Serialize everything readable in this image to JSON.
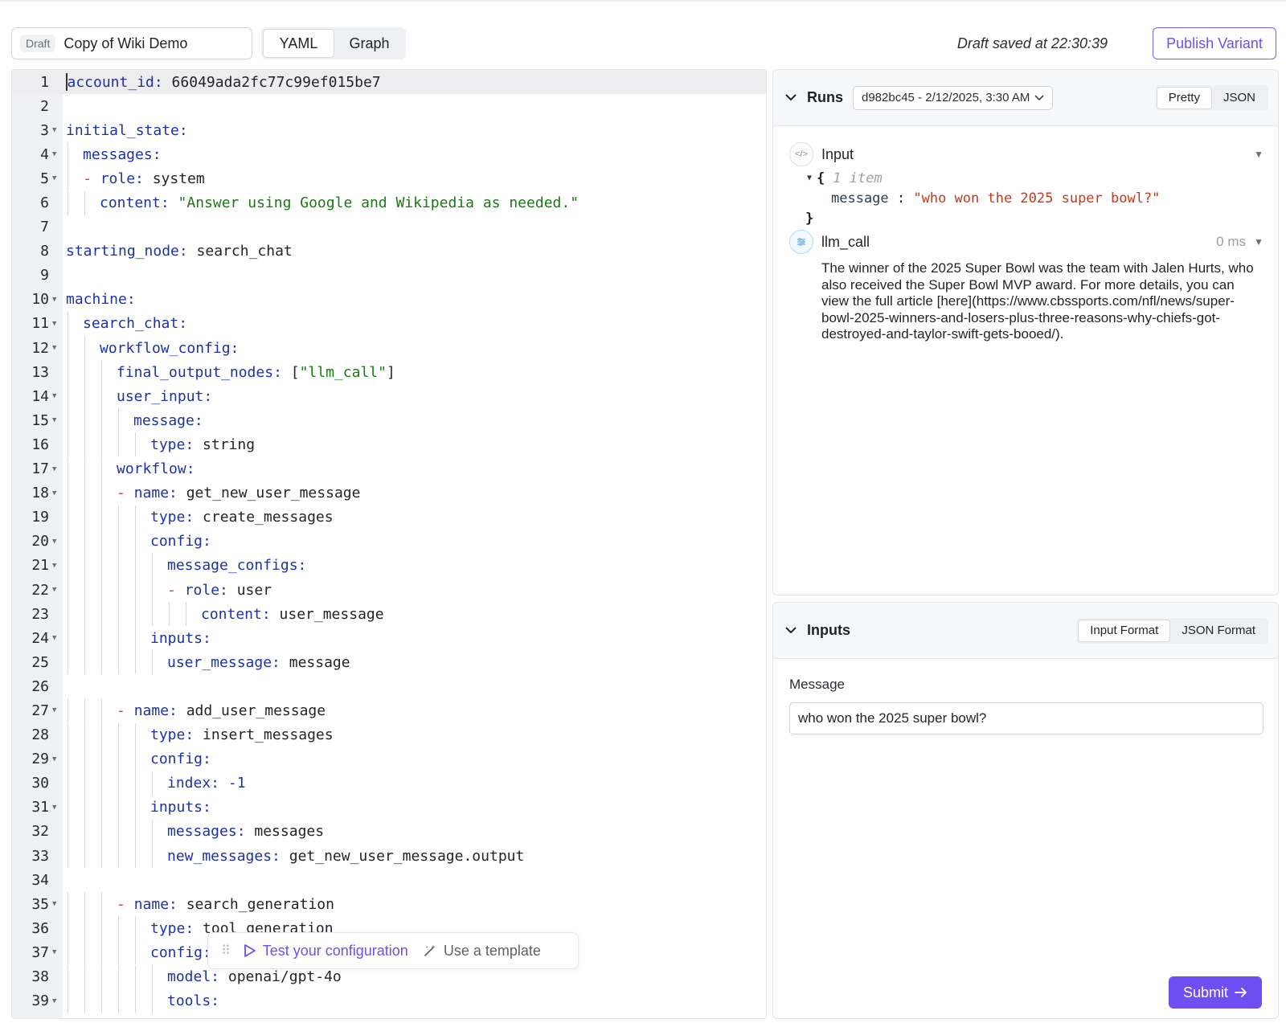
{
  "header": {
    "draft_badge": "Draft",
    "variant_name": "Copy of Wiki Demo",
    "tabs": [
      {
        "label": "YAML",
        "active": true
      },
      {
        "label": "Graph",
        "active": false
      }
    ],
    "saved_text": "Draft saved at 22:30:39",
    "publish_label": "Publish Variant"
  },
  "editor": {
    "lines": [
      {
        "n": "1",
        "fold": false,
        "indent": 0,
        "dash": false,
        "key": "account_id:",
        "val": " 66049ada2fc77c99ef015be7",
        "vclass": "v"
      },
      {
        "n": "2",
        "fold": false,
        "indent": 0,
        "dash": false,
        "key": "",
        "val": "",
        "vclass": "v"
      },
      {
        "n": "3",
        "fold": true,
        "indent": 0,
        "dash": false,
        "key": "initial_state:",
        "val": "",
        "vclass": "v"
      },
      {
        "n": "4",
        "fold": true,
        "indent": 1,
        "dash": false,
        "key": "messages:",
        "val": "",
        "vclass": "v"
      },
      {
        "n": "5",
        "fold": true,
        "indent": 1,
        "dash": true,
        "key": "role:",
        "val": " system",
        "vclass": "v"
      },
      {
        "n": "6",
        "fold": false,
        "indent": 2,
        "dash": false,
        "key": "content:",
        "val": " \"Answer using Google and Wikipedia as needed.\"",
        "vclass": "s"
      },
      {
        "n": "7",
        "fold": false,
        "indent": 0,
        "dash": false,
        "key": "",
        "val": "",
        "vclass": "v"
      },
      {
        "n": "8",
        "fold": false,
        "indent": 0,
        "dash": false,
        "key": "starting_node:",
        "val": " search_chat",
        "vclass": "v"
      },
      {
        "n": "9",
        "fold": false,
        "indent": 0,
        "dash": false,
        "key": "",
        "val": "",
        "vclass": "v"
      },
      {
        "n": "10",
        "fold": true,
        "indent": 0,
        "dash": false,
        "key": "machine:",
        "val": "",
        "vclass": "v"
      },
      {
        "n": "11",
        "fold": true,
        "indent": 1,
        "dash": false,
        "key": "search_chat:",
        "val": "",
        "vclass": "v"
      },
      {
        "n": "12",
        "fold": true,
        "indent": 2,
        "dash": false,
        "key": "workflow_config:",
        "val": "",
        "vclass": "v"
      },
      {
        "n": "13",
        "fold": false,
        "indent": 3,
        "dash": false,
        "key": "final_output_nodes:",
        "val": " [\"llm_call\"]",
        "vclass": "mixed"
      },
      {
        "n": "14",
        "fold": true,
        "indent": 3,
        "dash": false,
        "key": "user_input:",
        "val": "",
        "vclass": "v"
      },
      {
        "n": "15",
        "fold": true,
        "indent": 4,
        "dash": false,
        "key": "message:",
        "val": "",
        "vclass": "v"
      },
      {
        "n": "16",
        "fold": false,
        "indent": 5,
        "dash": false,
        "key": "type:",
        "val": " string",
        "vclass": "v"
      },
      {
        "n": "17",
        "fold": true,
        "indent": 3,
        "dash": false,
        "key": "workflow:",
        "val": "",
        "vclass": "v"
      },
      {
        "n": "18",
        "fold": true,
        "indent": 3,
        "dash": true,
        "key": "name:",
        "val": " get_new_user_message",
        "vclass": "v"
      },
      {
        "n": "19",
        "fold": false,
        "indent": 5,
        "dash": false,
        "key": "type:",
        "val": " create_messages",
        "vclass": "v"
      },
      {
        "n": "20",
        "fold": true,
        "indent": 5,
        "dash": false,
        "key": "config:",
        "val": "",
        "vclass": "v"
      },
      {
        "n": "21",
        "fold": true,
        "indent": 6,
        "dash": false,
        "key": "message_configs:",
        "val": "",
        "vclass": "v"
      },
      {
        "n": "22",
        "fold": true,
        "indent": 6,
        "dash": true,
        "key": "role:",
        "val": " user",
        "vclass": "v"
      },
      {
        "n": "23",
        "fold": false,
        "indent": 8,
        "dash": false,
        "key": "content:",
        "val": " user_message",
        "vclass": "v"
      },
      {
        "n": "24",
        "fold": true,
        "indent": 5,
        "dash": false,
        "key": "inputs:",
        "val": "",
        "vclass": "v"
      },
      {
        "n": "25",
        "fold": false,
        "indent": 6,
        "dash": false,
        "key": "user_message:",
        "val": " message",
        "vclass": "v"
      },
      {
        "n": "26",
        "fold": false,
        "indent": 0,
        "dash": false,
        "key": "",
        "val": "",
        "vclass": "v"
      },
      {
        "n": "27",
        "fold": true,
        "indent": 3,
        "dash": true,
        "key": "name:",
        "val": " add_user_message",
        "vclass": "v"
      },
      {
        "n": "28",
        "fold": false,
        "indent": 5,
        "dash": false,
        "key": "type:",
        "val": " insert_messages",
        "vclass": "v"
      },
      {
        "n": "29",
        "fold": true,
        "indent": 5,
        "dash": false,
        "key": "config:",
        "val": "",
        "vclass": "v"
      },
      {
        "n": "30",
        "fold": false,
        "indent": 6,
        "dash": false,
        "key": "index:",
        "val": " -1",
        "vclass": "n"
      },
      {
        "n": "31",
        "fold": true,
        "indent": 5,
        "dash": false,
        "key": "inputs:",
        "val": "",
        "vclass": "v"
      },
      {
        "n": "32",
        "fold": false,
        "indent": 6,
        "dash": false,
        "key": "messages:",
        "val": " messages",
        "vclass": "v"
      },
      {
        "n": "33",
        "fold": false,
        "indent": 6,
        "dash": false,
        "key": "new_messages:",
        "val": " get_new_user_message.output",
        "vclass": "v"
      },
      {
        "n": "34",
        "fold": false,
        "indent": 0,
        "dash": false,
        "key": "",
        "val": "",
        "vclass": "v"
      },
      {
        "n": "35",
        "fold": true,
        "indent": 3,
        "dash": true,
        "key": "name:",
        "val": " search_generation",
        "vclass": "v"
      },
      {
        "n": "36",
        "fold": false,
        "indent": 5,
        "dash": false,
        "key": "type:",
        "val": " tool_generation",
        "vclass": "v"
      },
      {
        "n": "37",
        "fold": true,
        "indent": 5,
        "dash": false,
        "key": "config:",
        "val": "",
        "vclass": "v"
      },
      {
        "n": "38",
        "fold": false,
        "indent": 6,
        "dash": false,
        "key": "model:",
        "val": " openai/gpt-4o",
        "vclass": "v"
      },
      {
        "n": "39",
        "fold": true,
        "indent": 6,
        "dash": false,
        "key": "tools:",
        "val": "",
        "vclass": "v"
      }
    ]
  },
  "floating_toolbar": {
    "test_label": "Test your configuration",
    "template_label": "Use a template"
  },
  "runs": {
    "title": "Runs",
    "selected_run": "d982bc45 - 2/12/2025, 3:30 AM",
    "view_options": [
      {
        "label": "Pretty",
        "active": true
      },
      {
        "label": "JSON",
        "active": false
      }
    ],
    "input_label": "Input",
    "input_json": {
      "open_brace": "{",
      "item_count": "1 item",
      "key": "message",
      "sep": " : ",
      "value": "\"who won the 2025 super bowl?\"",
      "close_brace": "}"
    },
    "llm_label": "llm_call",
    "llm_time": "0 ms",
    "llm_output": "The winner of the 2025 Super Bowl was the team with Jalen Hurts, who also received the Super Bowl MVP award. For more details, you can view the full article [here](https://www.cbssports.com/nfl/news/super-bowl-2025-winners-and-losers-plus-three-reasons-why-chiefs-got-destroyed-and-taylor-swift-gets-booed/)."
  },
  "inputs": {
    "title": "Inputs",
    "format_options": [
      {
        "label": "Input Format",
        "active": true
      },
      {
        "label": "JSON Format",
        "active": false
      }
    ],
    "message_label": "Message",
    "message_value": "who won the 2025 super bowl?",
    "submit_label": "Submit"
  }
}
